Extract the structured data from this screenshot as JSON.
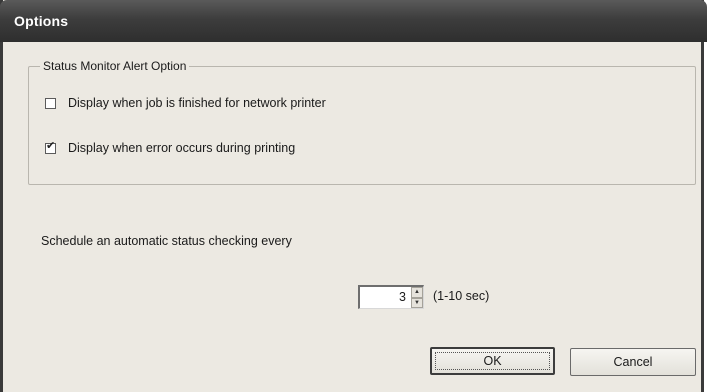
{
  "window": {
    "title": "Options"
  },
  "alert_group": {
    "legend": "Status Monitor Alert Option",
    "options": [
      {
        "label": "Display when job is finished for network printer",
        "checked": false
      },
      {
        "label": "Display when error occurs during printing",
        "checked": true
      }
    ]
  },
  "schedule": {
    "label": "Schedule an automatic status checking every",
    "value": "3",
    "range": "(1-10 sec)",
    "up_glyph": "▲",
    "down_glyph": "▼"
  },
  "buttons": {
    "ok": "OK",
    "cancel": "Cancel"
  },
  "check_glyph": "✔"
}
